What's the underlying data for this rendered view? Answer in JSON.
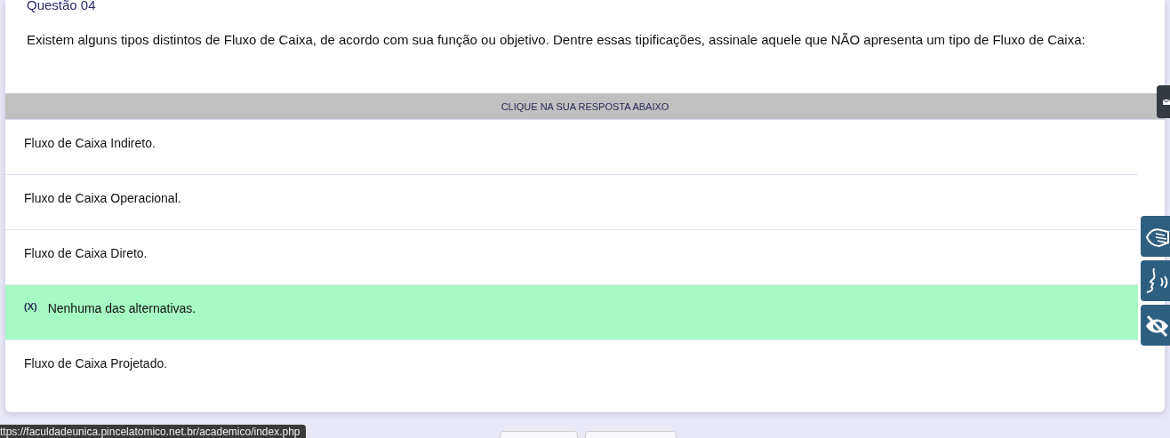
{
  "question": {
    "title": "Questão 04",
    "text": "Existem alguns tipos distintos de Fluxo de Caixa, de acordo com sua função ou objetivo. Dentre essas tipificações, assinale aquele que NÃO apresenta um tipo de Fluxo de Caixa:"
  },
  "answer_header": "CLIQUE NA SUA RESPOSTA ABAIXO",
  "selected_marker": "(X)",
  "options": [
    {
      "text": "Fluxo de Caixa Indireto.",
      "selected": false
    },
    {
      "text": "Fluxo de Caixa Operacional.",
      "selected": false
    },
    {
      "text": "Fluxo de Caixa Direto.",
      "selected": false
    },
    {
      "text": "Nenhuma das alternativas.",
      "selected": true
    },
    {
      "text": "Fluxo de Caixa Projetado.",
      "selected": false
    }
  ],
  "status_url": "ttps://faculdadeunica.pincelatomico.net.br/academico/index.php"
}
